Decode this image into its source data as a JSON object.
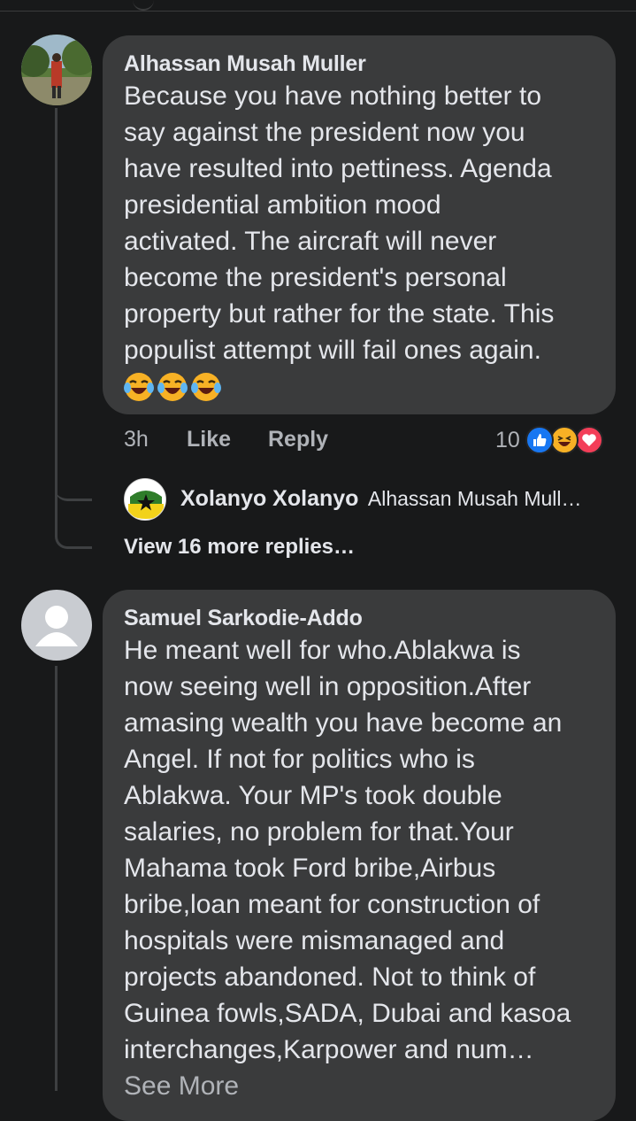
{
  "comments": [
    {
      "author": "Alhassan Musah Muller",
      "text": "Because you have nothing better to\nsay against the president now you\nhave resulted into pettiness. Agenda\npresidential ambition mood\nactivated. The aircraft will never\nbecome the president's personal\nproperty but rather for the state. This\npopulist attempt will fail ones again.",
      "emojis": [
        "laughing-tears-emoji",
        "laughing-tears-emoji",
        "laughing-tears-emoji"
      ],
      "time": "3h",
      "like_label": "Like",
      "reply_label": "Reply",
      "reaction_count": "10",
      "reactions": [
        "like-reaction",
        "haha-reaction",
        "love-reaction"
      ],
      "reply_preview": {
        "author": "Xolanyo Xolanyo",
        "text": "Alhassan Musah Mull…"
      },
      "view_more": "View 16 more replies…"
    },
    {
      "author": "Samuel Sarkodie-Addo",
      "text": "He meant well for who.Ablakwa is\nnow seeing well in opposition.After\namasing wealth you have become an\nAngel. If not for politics who is\nAblakwa. Your MP's took double\nsalaries, no problem for that.Your\nMahama took Ford bribe,Airbus\nbribe,loan meant for construction of\nhospitals were mismanaged and\nprojects abandoned. Not to think of\nGuinea fowls,SADA, Dubai and kasoa\ninterchanges,Karpower and num…",
      "see_more": "See More"
    }
  ],
  "colors": {
    "background": "#18191a",
    "bubble": "#3a3b3c",
    "primary_text": "#e4e6eb",
    "secondary_text": "#b0b3b8",
    "like_blue": "#1877f2",
    "love_red": "#f33e58",
    "haha_yellow": "#f7b125"
  }
}
